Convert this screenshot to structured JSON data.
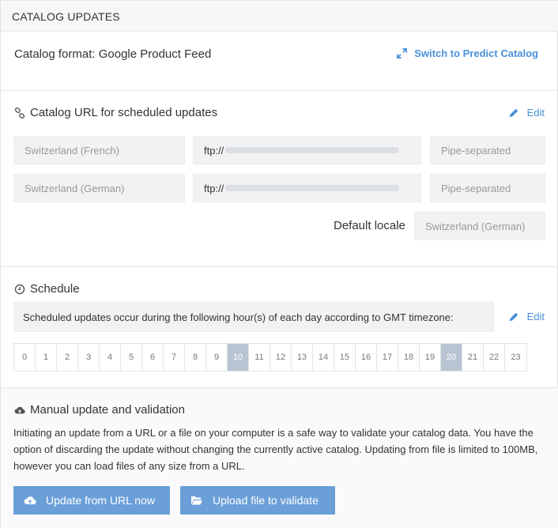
{
  "header": {
    "title": "CATALOG UPDATES"
  },
  "format": {
    "label": "Catalog format: Google Product Feed",
    "switch_link": "Switch to Predict Catalog"
  },
  "catalog_url": {
    "title": "Catalog URL for scheduled updates",
    "edit_label": "Edit",
    "rows": [
      {
        "locale": "Switzerland (French)",
        "url_prefix": "ftp://",
        "separator": "Pipe-separated"
      },
      {
        "locale": "Switzerland (German)",
        "url_prefix": "ftp://",
        "separator": "Pipe-separated"
      }
    ],
    "default_locale_label": "Default locale",
    "default_locale_value": "Switzerland (German)"
  },
  "schedule": {
    "title": "Schedule",
    "edit_label": "Edit",
    "description": "Scheduled updates occur during the following hour(s) of each day according to GMT timezone:",
    "hours": [
      "0",
      "1",
      "2",
      "3",
      "4",
      "5",
      "6",
      "7",
      "8",
      "9",
      "10",
      "11",
      "12",
      "13",
      "14",
      "15",
      "16",
      "17",
      "18",
      "19",
      "20",
      "21",
      "22",
      "23"
    ],
    "selected_hours": [
      "10",
      "20"
    ]
  },
  "manual": {
    "title": "Manual update and validation",
    "description": "Initiating an update from a URL or a file on your computer is a safe way to validate your catalog data. You have the option of discarding the update without changing the currently active catalog. Updating from file is limited to 100MB, however you can load files of any size from a URL.",
    "btn_url": "Update from URL now",
    "btn_file": "Upload file to validate"
  },
  "colors": {
    "accent": "#4a90d9",
    "button": "#6a9fd8",
    "selected_hour": "#b8c4d2"
  },
  "icons": {
    "switch": "expand-arrows-icon",
    "link": "link-icon",
    "edit": "pencil-icon",
    "schedule": "clock-icon",
    "manual": "cloud-upload-icon",
    "upload": "folder-open-icon"
  }
}
